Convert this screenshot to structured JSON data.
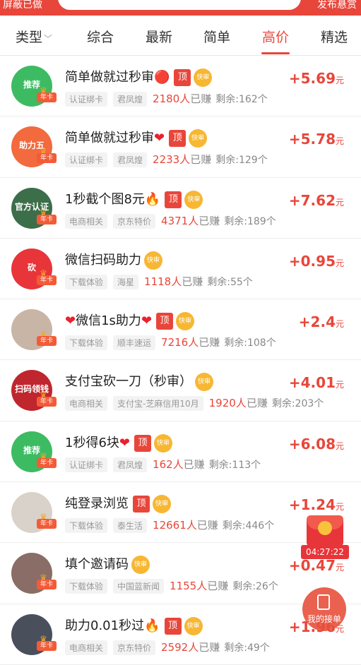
{
  "topbar": {
    "left_text": "屏蔽已做",
    "right_text": "发布悬赏"
  },
  "tabs": [
    {
      "label": "类型",
      "caret": "﹀"
    },
    {
      "label": "综合"
    },
    {
      "label": "最新"
    },
    {
      "label": "简单"
    },
    {
      "label": "高价"
    },
    {
      "label": "精选"
    }
  ],
  "active_tab": "高价",
  "badge_label": "年卡",
  "tag_ding": "顶",
  "tag_kuai": "快审",
  "earned_suffix": "已赚",
  "remain_prefix": "剩余:",
  "remain_suffix": "个",
  "price_unit": "元",
  "tasks": [
    {
      "title": "简单做就过秒审",
      "title_emoji": "🔴",
      "cat": "认证绑卡",
      "user": "君凤煌",
      "earned": "2180人",
      "remain": "162",
      "price": "+5.69",
      "avatar_text": "推荐",
      "avatar_color": "#3dbb63"
    },
    {
      "title": "简单做就过秒审",
      "title_emoji": "❤",
      "cat": "认证绑卡",
      "user": "君凤煌",
      "earned": "2233人",
      "remain": "129",
      "price": "+5.78",
      "avatar_text": "助力五",
      "avatar_color": "#f26a3d"
    },
    {
      "title": "1秒截个图8元",
      "title_emoji": "🔥",
      "cat": "电商相关",
      "user": "京东特价",
      "earned": "4371人",
      "remain": "189",
      "price": "+7.62",
      "avatar_text": "官方认证",
      "avatar_color": "#3c6e4a"
    },
    {
      "title": "微信扫码助力",
      "title_emoji": "",
      "cat": "下载体验",
      "user": "海星",
      "earned": "1118人",
      "remain": "55",
      "price": "+0.95",
      "avatar_text": "砍",
      "avatar_color": "#e8353a"
    },
    {
      "title_pre": "❤",
      "title": "微信1s助力",
      "title_emoji": "❤",
      "cat": "下载体验",
      "user": "顺丰速运",
      "earned": "7216人",
      "remain": "108",
      "price": "+2.4",
      "avatar_text": "",
      "avatar_color": "#c9b5a6"
    },
    {
      "title": "支付宝砍一刀（秒审）",
      "title_emoji": "",
      "cat": "电商相关",
      "user": "支付宝-芝麻信用10月",
      "earned": "1920人",
      "remain": "203",
      "price": "+4.01",
      "avatar_text": "扫码领钱",
      "avatar_color": "#c0262d"
    },
    {
      "title": "1秒得6块",
      "title_emoji": "❤",
      "cat": "认证绑卡",
      "user": "君凤煌",
      "earned": "162人",
      "remain": "113",
      "price": "+6.08",
      "avatar_text": "推荐",
      "avatar_color": "#3dbb63"
    },
    {
      "title": "纯登录浏览",
      "title_emoji": "",
      "cat": "下载体验",
      "user": "泰生活",
      "earned": "12661人",
      "remain": "446",
      "price": "+1.24",
      "avatar_text": "",
      "avatar_color": "#d8d2cb"
    },
    {
      "title": "填个邀请码",
      "title_emoji": "",
      "cat": "下载体验",
      "user": "中国蓝新闻",
      "earned": "1155人",
      "remain": "26",
      "price": "+0.47",
      "avatar_text": "",
      "avatar_color": "#8a6d66"
    },
    {
      "title": "助力0.01秒过",
      "title_emoji": "🔥",
      "cat": "电商相关",
      "user": "京东特价",
      "earned": "2592人",
      "remain": "49",
      "price": "+1.96",
      "avatar_text": "",
      "avatar_color": "#4a4f5c"
    }
  ],
  "float": {
    "timer": "04:27:22",
    "jiedan_label": "我的接单"
  }
}
